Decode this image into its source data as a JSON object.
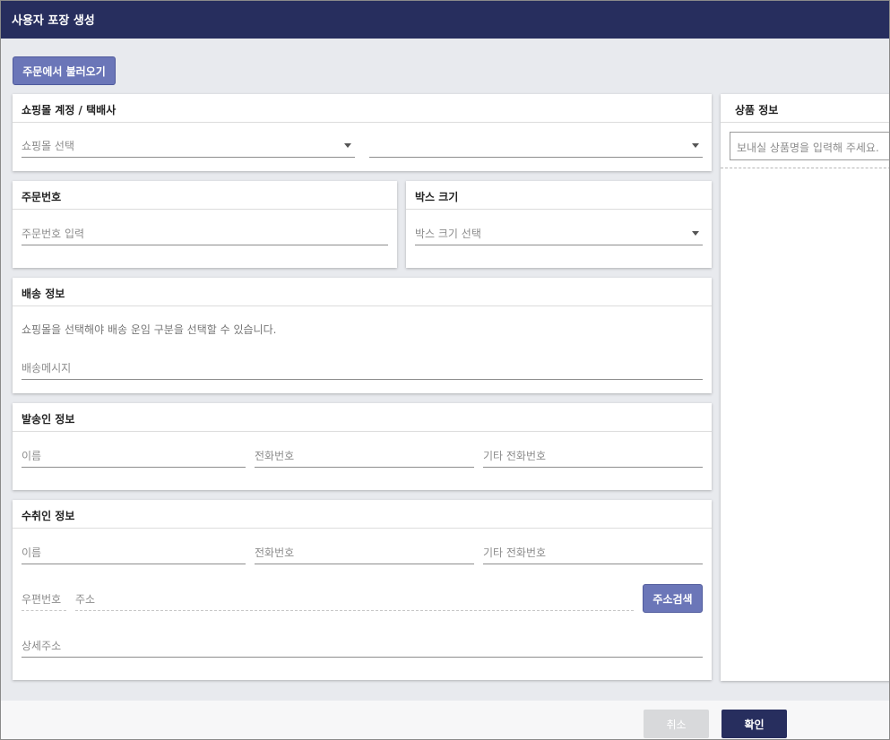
{
  "window": {
    "title": "사용자 포장 생성"
  },
  "toolbar": {
    "load_from_order_label": "주문에서 불러오기"
  },
  "mall_carrier": {
    "header": "쇼핑몰 계정 / 택배사",
    "mall_placeholder": "쇼핑몰 선택",
    "carrier_value": ""
  },
  "order_number": {
    "header": "주문번호",
    "placeholder": "주문번호 입력"
  },
  "box_size": {
    "header": "박스 크기",
    "placeholder": "박스 크기 선택"
  },
  "shipping": {
    "header": "배송 정보",
    "notice": "쇼핑몰을 선택해야 배송 운임 구분을 선택할 수 있습니다.",
    "message_placeholder": "배송메시지"
  },
  "sender": {
    "header": "발송인 정보",
    "name_placeholder": "이름",
    "phone_placeholder": "전화번호",
    "other_phone_placeholder": "기타 전화번호"
  },
  "recipient": {
    "header": "수취인 정보",
    "name_placeholder": "이름",
    "phone_placeholder": "전화번호",
    "other_phone_placeholder": "기타 전화번호",
    "zip_placeholder": "우편번호",
    "address_placeholder": "주소",
    "address_search_label": "주소검색",
    "detail_address_placeholder": "상세주소"
  },
  "product": {
    "header": "상품 정보",
    "name_placeholder": "보내실 상품명을 입력해 주세요."
  },
  "footer": {
    "cancel_label": "취소",
    "confirm_label": "확인"
  },
  "colors": {
    "titlebar": "#272e5e",
    "primary_button": "#6b76b8",
    "confirm_button": "#272e5e",
    "cancel_button": "#d8d9db"
  }
}
